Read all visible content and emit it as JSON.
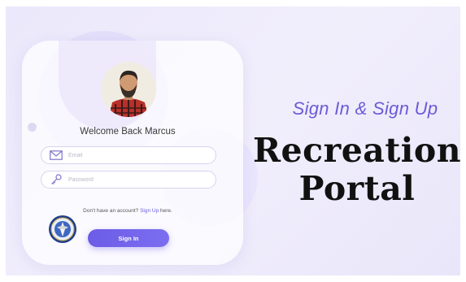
{
  "header": {
    "subtitle": "Sign In & Sign Up",
    "title_line1": "Recreation",
    "title_line2": "Portal"
  },
  "login": {
    "welcome": "Welcome Back Marcus",
    "email_placeholder": "Email",
    "password_placeholder": "Password",
    "signup_prefix": "Don't have an account?",
    "signup_link": "Sign Up",
    "signup_suffix": "here.",
    "signin_label": "Sign In"
  },
  "icons": {
    "email": "mail-icon",
    "password": "key-icon",
    "avatar": "user-avatar",
    "seal": "seal-logo"
  },
  "colors": {
    "accent": "#6c5ce7",
    "subtitle": "#6b5bd6",
    "background": "#ece9fb"
  }
}
